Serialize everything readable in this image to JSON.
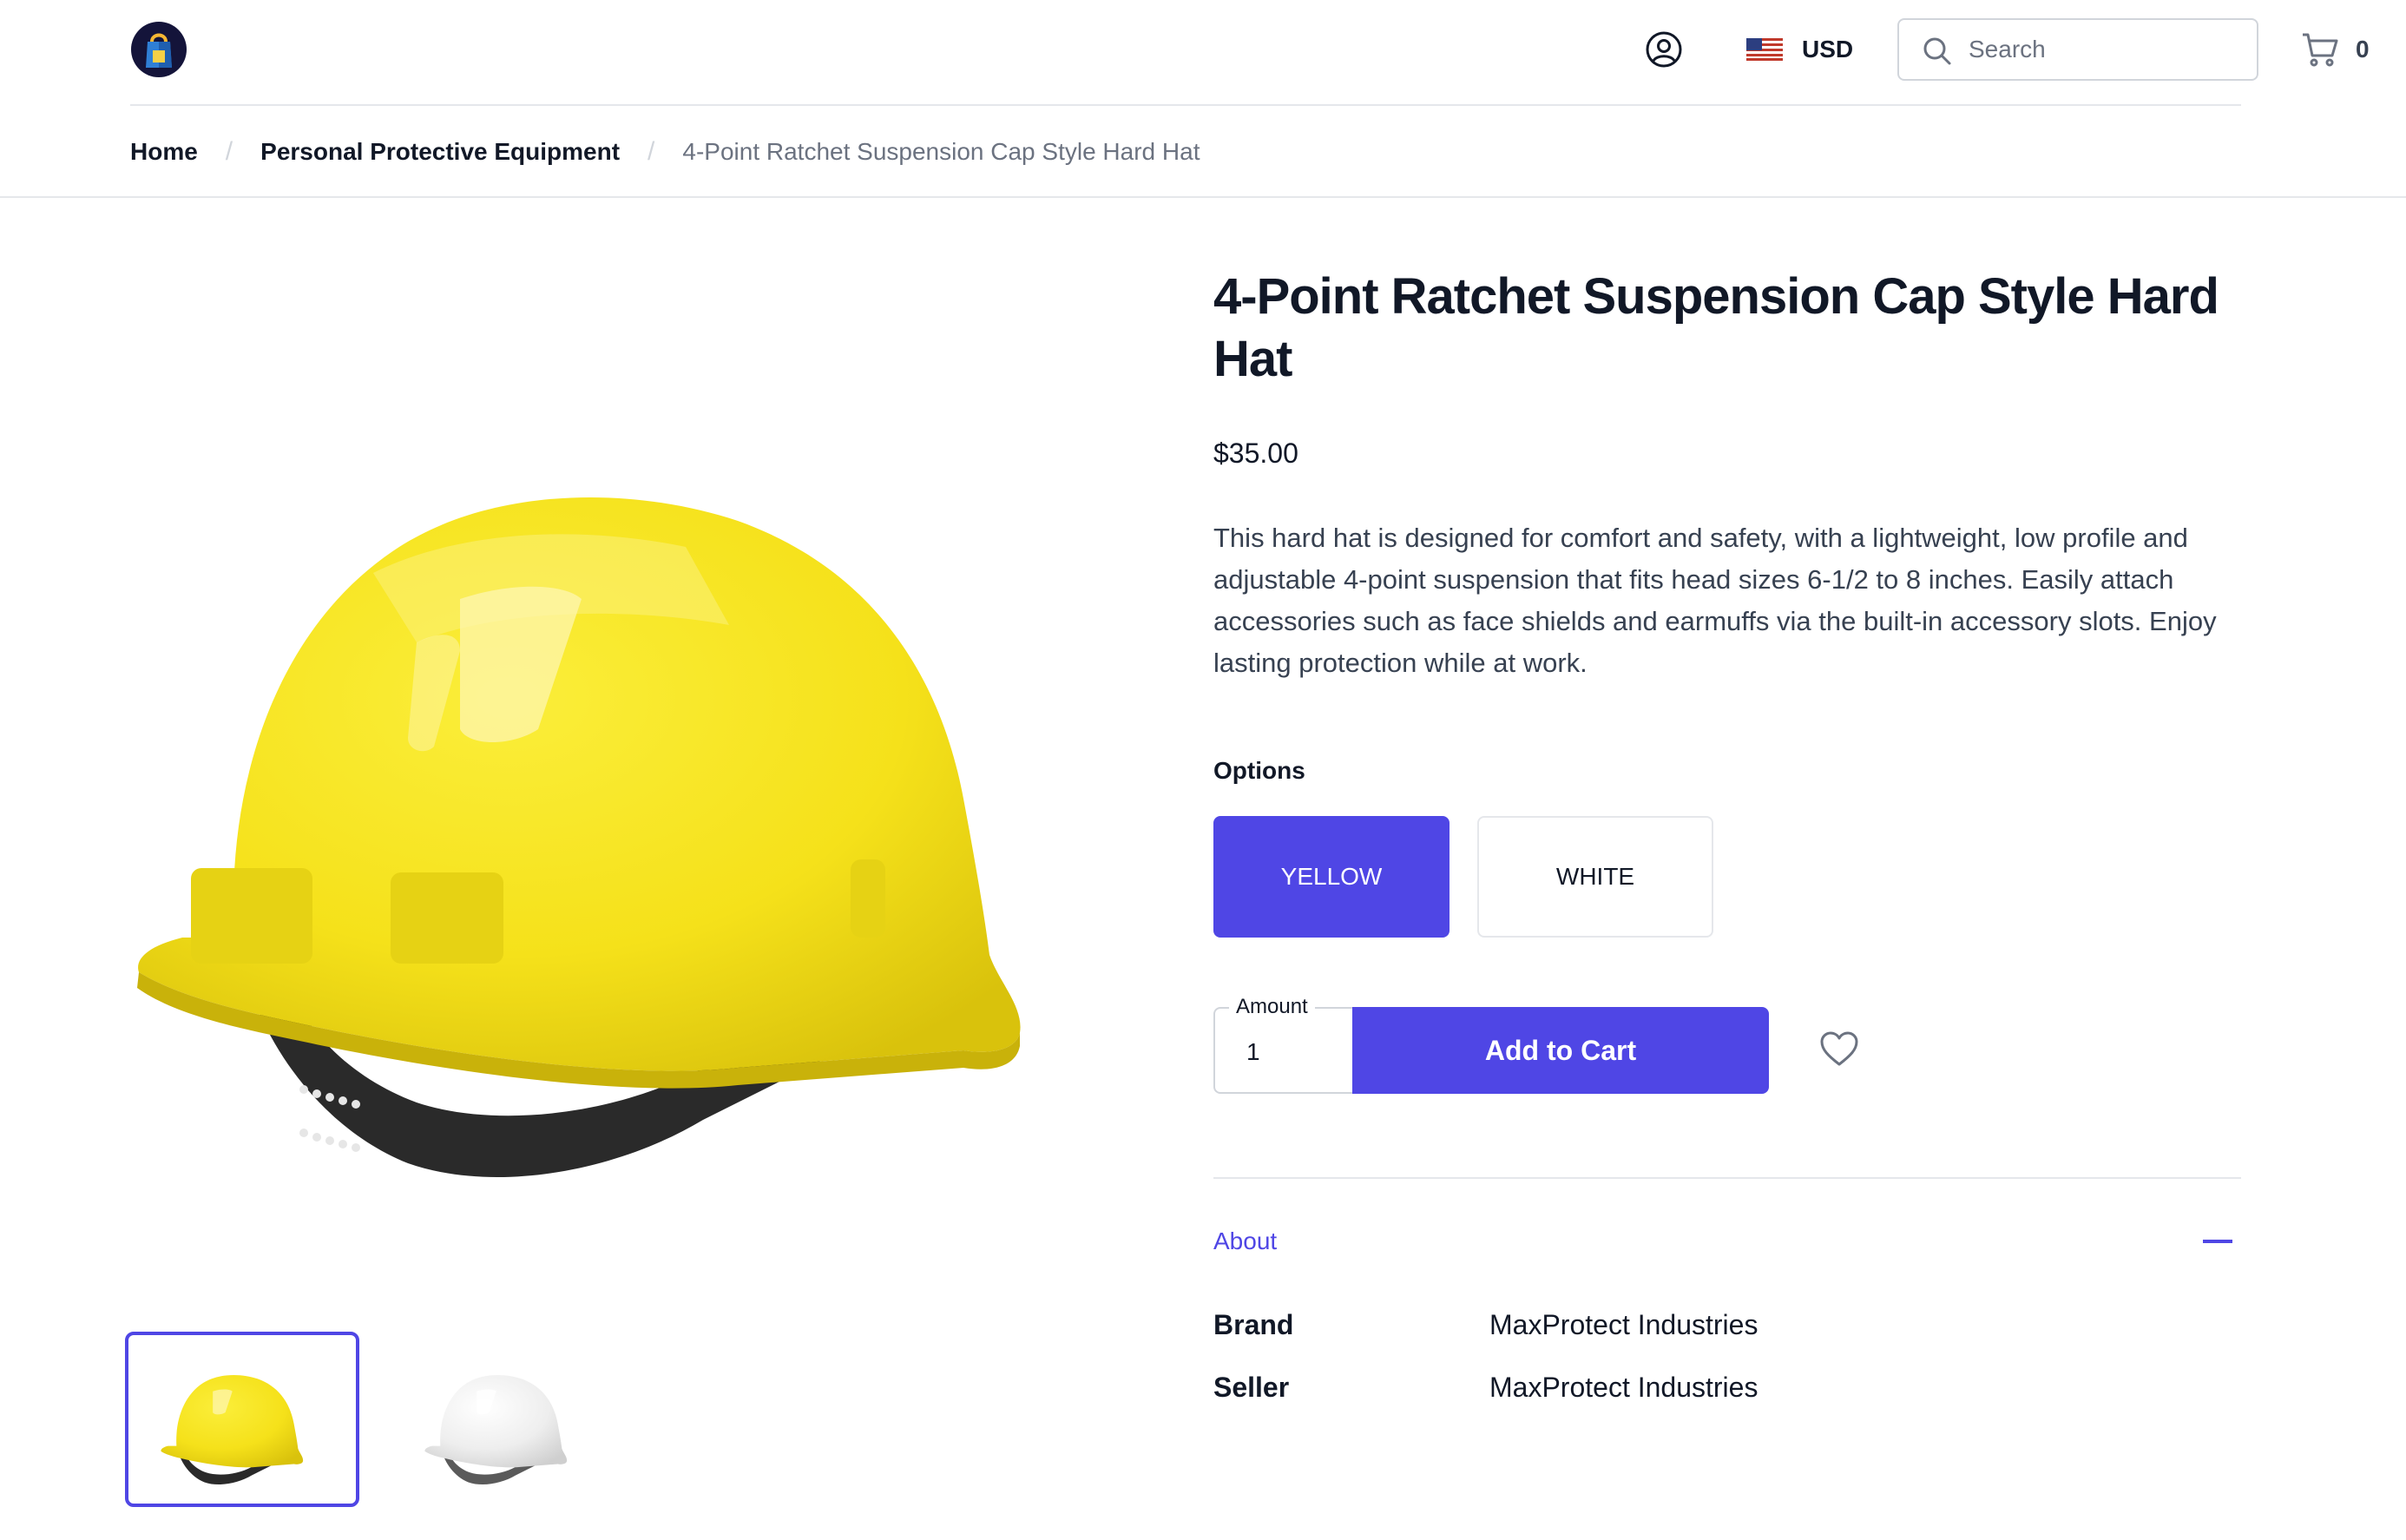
{
  "header": {
    "currency": "USD",
    "search_placeholder": "Search",
    "cart_count": "0"
  },
  "breadcrumb": {
    "home": "Home",
    "category": "Personal Protective Equipment",
    "current": "4-Point Ratchet Suspension Cap Style Hard Hat"
  },
  "product": {
    "title": "4-Point Ratchet Suspension Cap Style Hard Hat",
    "price": "$35.00",
    "description": "This hard hat is designed for comfort and safety, with a lightweight, low profile and adjustable 4-point suspension that fits head sizes 6-1/2 to 8 inches. Easily attach accessories such as face shields and earmuffs via the built-in accessory slots. Enjoy lasting protection while at work.",
    "options_label": "Options",
    "options": [
      "YELLOW",
      "WHITE"
    ],
    "selected_option": "YELLOW",
    "amount_label": "Amount",
    "amount_value": "1",
    "add_to_cart_label": "Add to Cart",
    "about_label": "About",
    "specs": [
      {
        "key": "Brand",
        "value": "MaxProtect Industries"
      },
      {
        "key": "Seller",
        "value": "MaxProtect Industries"
      }
    ]
  },
  "colors": {
    "accent": "#4f46e5",
    "hat_yellow": "#f5e11a",
    "hat_white": "#f2f2f2"
  },
  "icons": {
    "logo": "shopping-bag-logo",
    "account": "user-circle-icon",
    "flag": "us-flag-icon",
    "search": "search-icon",
    "cart": "shopping-cart-icon",
    "wishlist": "heart-icon",
    "collapse": "minus-icon"
  }
}
